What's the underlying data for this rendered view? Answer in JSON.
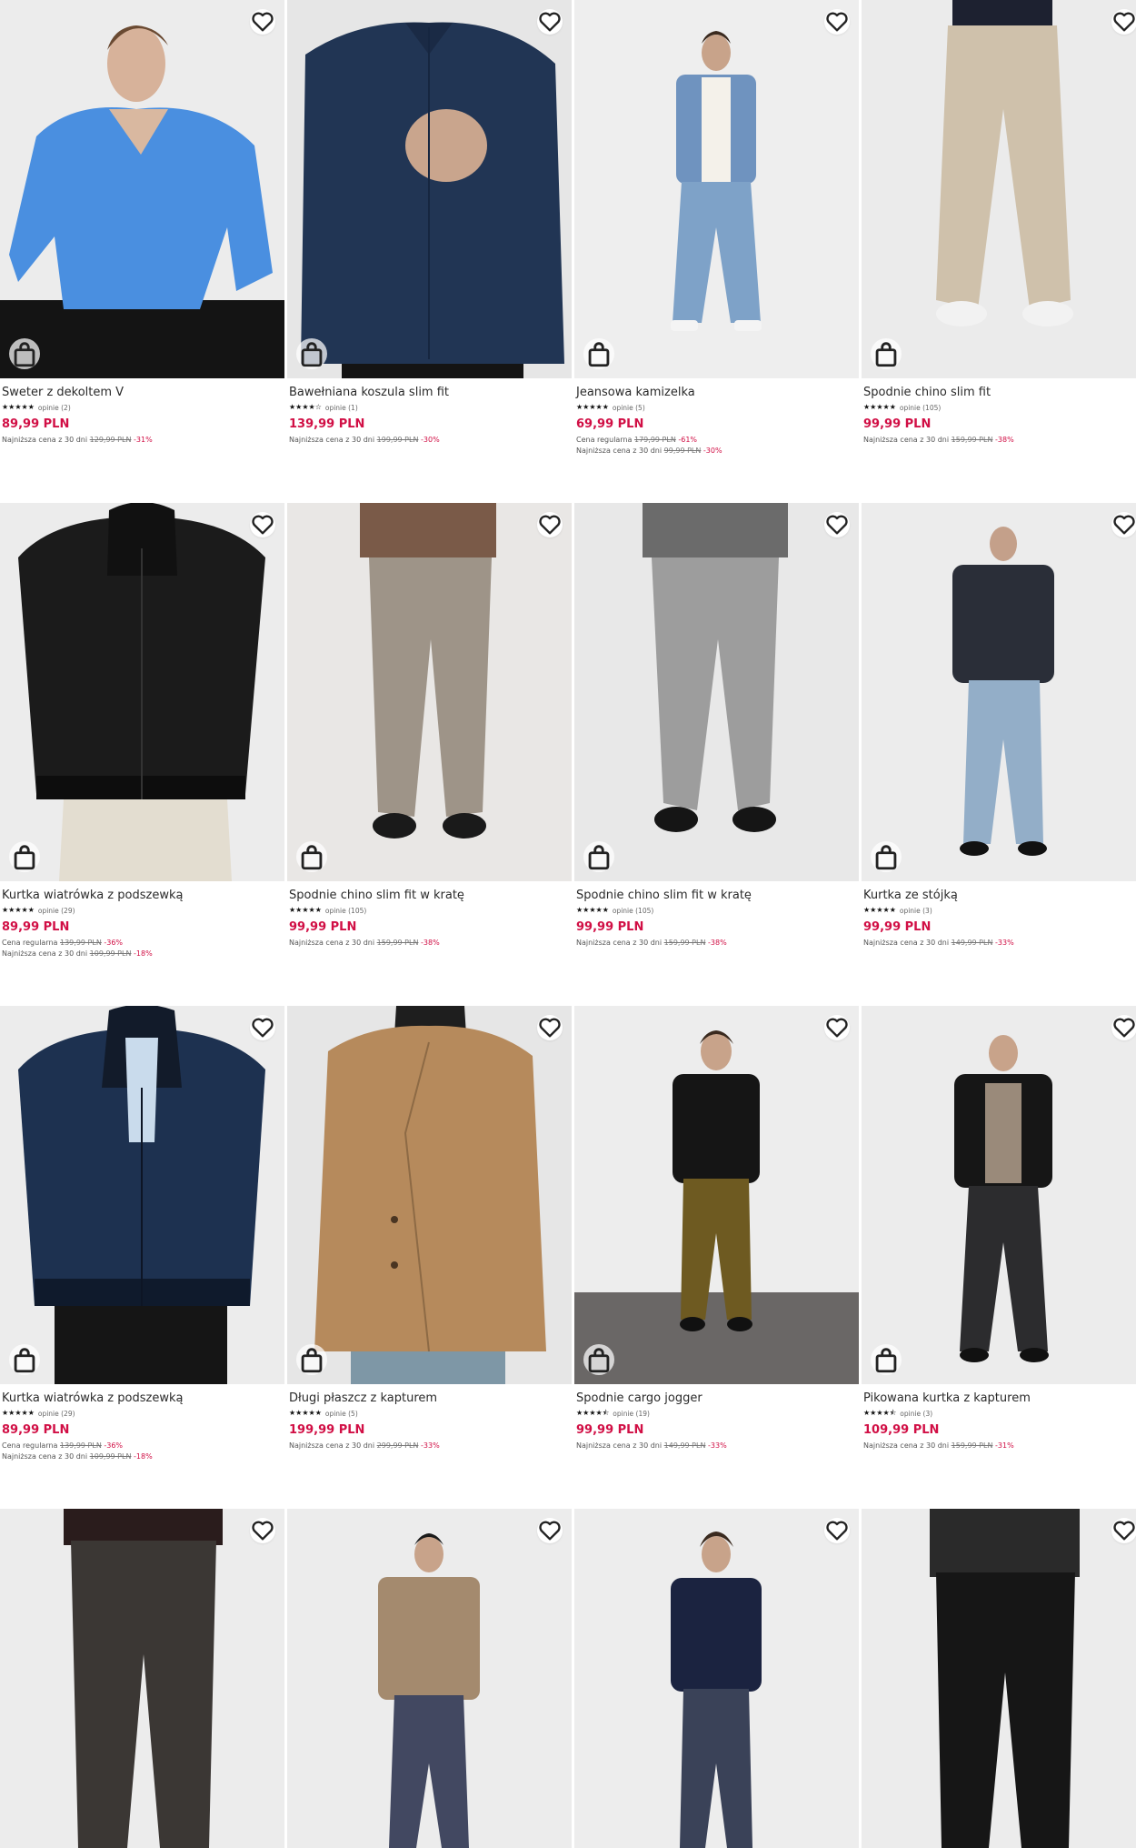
{
  "products": [
    {
      "title": "Sweter z dekoltem V",
      "stars": "★★★★★",
      "reviews": "opinie (2)",
      "price": "89,99 PLN",
      "lines": [
        {
          "label": "Najniższa cena z 30 dni",
          "old": "129,99 PLN",
          "disc": "-31%"
        }
      ]
    },
    {
      "title": "Bawełniana koszula slim fit",
      "stars": "★★★★☆",
      "reviews": "opinie (1)",
      "price": "139,99 PLN",
      "lines": [
        {
          "label": "Najniższa cena z 30 dni",
          "old": "199,99 PLN",
          "disc": "-30%"
        }
      ]
    },
    {
      "title": "Jeansowa kamizelka",
      "stars": "★★★★★",
      "reviews": "opinie (5)",
      "price": "69,99 PLN",
      "lines": [
        {
          "label": "Cena regularna",
          "old": "179,99 PLN",
          "disc": "-61%"
        },
        {
          "label": "Najniższa cena z 30 dni",
          "old": "99,99 PLN",
          "disc": "-30%"
        }
      ]
    },
    {
      "title": "Spodnie chino slim fit",
      "stars": "★★★★★",
      "reviews": "opinie (105)",
      "price": "99,99 PLN",
      "lines": [
        {
          "label": "Najniższa cena z 30 dni",
          "old": "159,99 PLN",
          "disc": "-38%"
        }
      ]
    },
    {
      "title": "Kurtka wiatrówka z podszewką",
      "stars": "★★★★★",
      "reviews": "opinie (29)",
      "price": "89,99 PLN",
      "lines": [
        {
          "label": "Cena regularna",
          "old": "139,99 PLN",
          "disc": "-36%"
        },
        {
          "label": "Najniższa cena z 30 dni",
          "old": "109,99 PLN",
          "disc": "-18%"
        }
      ]
    },
    {
      "title": "Spodnie chino slim fit w kratę",
      "stars": "★★★★★",
      "reviews": "opinie (105)",
      "price": "99,99 PLN",
      "lines": [
        {
          "label": "Najniższa cena z 30 dni",
          "old": "159,99 PLN",
          "disc": "-38%"
        }
      ]
    },
    {
      "title": "Spodnie chino slim fit w kratę",
      "stars": "★★★★★",
      "reviews": "opinie (105)",
      "price": "99,99 PLN",
      "lines": [
        {
          "label": "Najniższa cena z 30 dni",
          "old": "159,99 PLN",
          "disc": "-38%"
        }
      ]
    },
    {
      "title": "Kurtka ze stójką",
      "stars": "★★★★★",
      "reviews": "opinie (3)",
      "price": "99,99 PLN",
      "lines": [
        {
          "label": "Najniższa cena z 30 dni",
          "old": "149,99 PLN",
          "disc": "-33%"
        }
      ]
    },
    {
      "title": "Kurtka wiatrówka z podszewką",
      "stars": "★★★★★",
      "reviews": "opinie (29)",
      "price": "89,99 PLN",
      "lines": [
        {
          "label": "Cena regularna",
          "old": "139,99 PLN",
          "disc": "-36%"
        },
        {
          "label": "Najniższa cena z 30 dni",
          "old": "109,99 PLN",
          "disc": "-18%"
        }
      ]
    },
    {
      "title": "Długi płaszcz z kapturem",
      "stars": "★★★★★",
      "reviews": "opinie (5)",
      "price": "199,99 PLN",
      "lines": [
        {
          "label": "Najniższa cena z 30 dni",
          "old": "299,99 PLN",
          "disc": "-33%"
        }
      ]
    },
    {
      "title": "Spodnie cargo jogger",
      "stars": "★★★★⯪",
      "reviews": "opinie (19)",
      "price": "99,99 PLN",
      "lines": [
        {
          "label": "Najniższa cena z 30 dni",
          "old": "149,99 PLN",
          "disc": "-33%"
        }
      ]
    },
    {
      "title": "Pikowana kurtka z kapturem",
      "stars": "★★★★⯪",
      "reviews": "opinie (3)",
      "price": "109,99 PLN",
      "lines": [
        {
          "label": "Najniższa cena z 30 dni",
          "old": "159,99 PLN",
          "disc": "-31%"
        }
      ]
    },
    {
      "title": "",
      "stars": "",
      "reviews": "",
      "price": "",
      "lines": []
    },
    {
      "title": "",
      "stars": "",
      "reviews": "",
      "price": "",
      "lines": []
    },
    {
      "title": "",
      "stars": "",
      "reviews": "",
      "price": "",
      "lines": []
    },
    {
      "title": "",
      "stars": "",
      "reviews": "",
      "price": "",
      "lines": []
    }
  ],
  "icons": {
    "favorite": "heart-icon",
    "add_to_cart": "shopping-bag-icon"
  },
  "colors": {
    "price": "#d10f45",
    "discount": "#d10f45",
    "text": "#2a2a2a"
  }
}
